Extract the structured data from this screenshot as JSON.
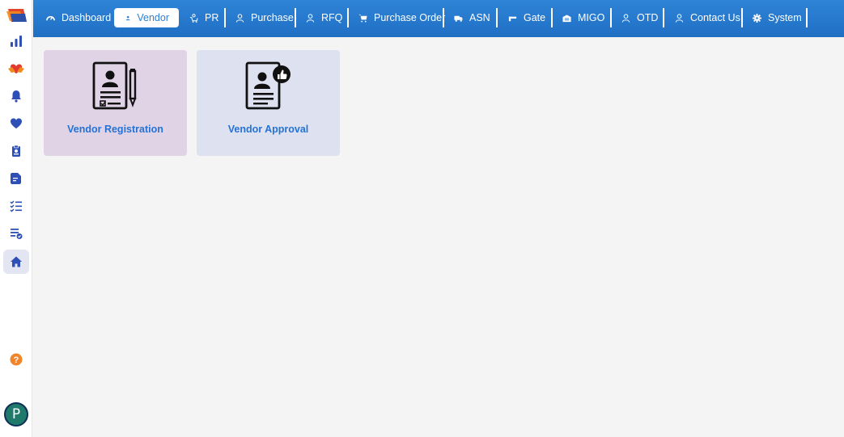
{
  "nav": {
    "tabs": [
      {
        "label": "Dashboard",
        "icon": "gauge-icon"
      },
      {
        "label": "Vendor",
        "icon": "person-icon",
        "active": true
      },
      {
        "label": "PR",
        "icon": "cart-person-icon"
      },
      {
        "label": "Purchase",
        "icon": "user-outline-icon"
      },
      {
        "label": "RFQ",
        "icon": "user-outline-icon"
      },
      {
        "label": "Purchase Order",
        "icon": "cart-icon"
      },
      {
        "label": "ASN",
        "icon": "truck-icon"
      },
      {
        "label": "Gate",
        "icon": "gate-icon"
      },
      {
        "label": "MIGO",
        "icon": "warehouse-icon"
      },
      {
        "label": "OTD",
        "icon": "user-outline-icon"
      },
      {
        "label": "Contact Us",
        "icon": "user-outline-icon"
      },
      {
        "label": "System",
        "icon": "gear-icon"
      }
    ]
  },
  "sidebar": {
    "items": [
      {
        "name": "chart-icon"
      },
      {
        "name": "hands-heart-icon"
      },
      {
        "name": "bell-icon"
      },
      {
        "name": "heart-icon"
      },
      {
        "name": "clipboard-icon"
      },
      {
        "name": "document-icon"
      },
      {
        "name": "checklist-icon"
      },
      {
        "name": "list-check-icon"
      },
      {
        "name": "home-icon",
        "active": true
      }
    ],
    "help_icon": "help-icon",
    "avatar_initial": "P"
  },
  "cards": [
    {
      "label": "Vendor Registration",
      "icon": "registration-document-icon",
      "bg": "#e0d3e6"
    },
    {
      "label": "Vendor Approval",
      "icon": "approval-document-icon",
      "bg": "#dde1f0"
    }
  ],
  "colors": {
    "nav_bg": "#2a7fd4",
    "accent_text": "#2672d4",
    "active_tab_bg": "#ffffff",
    "page_bg": "#f4f4f4"
  }
}
